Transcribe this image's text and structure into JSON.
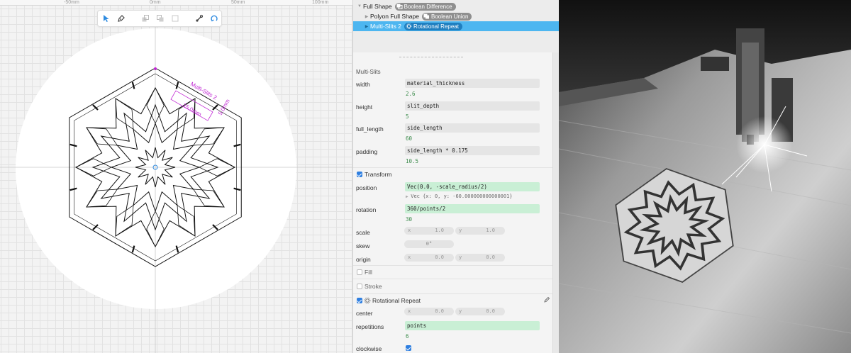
{
  "ruler": {
    "labels": [
      "-50mm",
      "0mm",
      "50mm",
      "100mm"
    ]
  },
  "toolbar": {
    "tools": [
      "pointer-icon",
      "pen-icon",
      "bring-front-icon",
      "send-back-icon",
      "align-icon",
      "link-icon",
      "repeat-icon"
    ]
  },
  "canvas": {
    "shape_label": "Multi-Slits 2",
    "dim_width": "15.0mm",
    "dim_height": "5.0mm",
    "accent_color": "#c026d3"
  },
  "tree": {
    "rows": [
      {
        "name": "Full Shape",
        "badge": "Boolean Difference"
      },
      {
        "name": "Polyon Full Shape",
        "badge": "Boolean Union"
      },
      {
        "name": "Multi-Slits 2",
        "badge": "Rotational Repeat",
        "selected": true
      }
    ]
  },
  "props": {
    "section_title": "Multi-Slits",
    "width": {
      "label": "width",
      "expr": "material_thickness",
      "value": "2.6"
    },
    "height": {
      "label": "height",
      "expr": "slit_depth",
      "value": "5"
    },
    "full_length": {
      "label": "full_length",
      "expr": "side_length",
      "value": "60"
    },
    "padding": {
      "label": "padding",
      "expr": "side_length * 0.175",
      "value": "10.5"
    },
    "transform_title": "Transform",
    "position": {
      "label": "position",
      "expr": "Vec(0.0, -scale_radius/2)",
      "vec": "Vec {x: 0, y: -60.000000000000001}"
    },
    "rotation": {
      "label": "rotation",
      "expr": "360/points/2",
      "value": "30"
    },
    "scale": {
      "label": "scale",
      "x_axis": "x",
      "x": "1.0",
      "y_axis": "y",
      "y": "1.0"
    },
    "skew": {
      "label": "skew",
      "value": "0°"
    },
    "origin": {
      "label": "origin",
      "x_axis": "x",
      "x": "0.0",
      "y_axis": "y",
      "y": "0.0"
    },
    "fill_label": "Fill",
    "stroke_label": "Stroke",
    "repeat_title": "Rotational Repeat",
    "center": {
      "label": "center",
      "x_axis": "x",
      "x": "0.0",
      "y_axis": "y",
      "y": "0.0"
    },
    "repetitions": {
      "label": "repetitions",
      "expr": "points",
      "value": "6"
    },
    "clockwise": {
      "label": "clockwise"
    }
  },
  "colors": {
    "selection": "#4db6f0",
    "green_expr": "#c9efd5",
    "checkbox": "#2f7fe0"
  }
}
